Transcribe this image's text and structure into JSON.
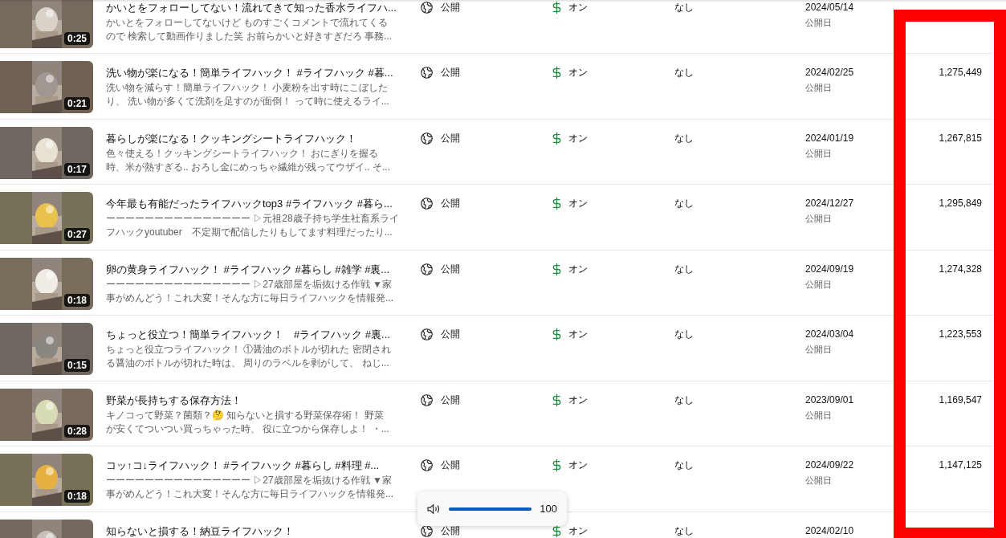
{
  "rows": [
    {
      "duration": "0:25",
      "title": "かいとをフォローしてない！流れてきて知った香水ライフハ...",
      "description_lines": [
        "かいとをフォローしてないけど ものすごくコメントで流れてくる",
        "ので 検索して動画作りました笑 お前らかいと好きすぎだろ 事務..."
      ],
      "visibility": "公開",
      "monetization": "オン",
      "restrictions": "なし",
      "date": "2024/05/14",
      "date_label": "公開日"
    },
    {
      "duration": "0:21",
      "title": "洗い物が楽になる！簡単ライフハック！ #ライフハック #暮...",
      "description_lines": [
        "洗い物を減らす！簡単ライフハック！ 小麦粉を出す時にこぼした",
        "り、 洗い物が多くて洗剤を足すのが面倒！ って時に使えるライ..."
      ],
      "visibility": "公開",
      "monetization": "オン",
      "restrictions": "なし",
      "date": "2024/02/25",
      "date_label": "公開日",
      "views": "1,275,449"
    },
    {
      "duration": "0:17",
      "title": "暮らしが楽になる！クッキングシートライフハック！",
      "description_lines": [
        "色々使える！クッキングシートライフハック！ おにぎりを握る",
        "時、米が熱すぎる.. おろし金にめっちゃ繊維が残ってウザイ.. そ..."
      ],
      "visibility": "公開",
      "monetization": "オン",
      "restrictions": "なし",
      "date": "2024/01/19",
      "date_label": "公開日",
      "views": "1,267,815"
    },
    {
      "duration": "0:27",
      "title": "今年最も有能だったライフハックtop3 #ライフハック #暮ら...",
      "description_lines": [
        "ーーーーーーーーーーーーーーー ▷元祖28歳子持ち学生社畜系ライ",
        "フハックyoutuber　不定期で配信したりもしてます料理だったり..."
      ],
      "visibility": "公開",
      "monetization": "オン",
      "restrictions": "なし",
      "date": "2024/12/27",
      "date_label": "公開日",
      "views": "1,295,849"
    },
    {
      "duration": "0:18",
      "title": "卵の黄身ライフハック！ #ライフハック #暮らし #雑学 #裏...",
      "description_lines": [
        "ーーーーーーーーーーーーーーー ▷27歳部屋を垢抜ける作戦 ▼家",
        "事がめんどう！これ大変！そんな方に毎日ライフハックを情報発..."
      ],
      "visibility": "公開",
      "monetization": "オン",
      "restrictions": "なし",
      "date": "2024/09/19",
      "date_label": "公開日",
      "views": "1,274,328"
    },
    {
      "duration": "0:15",
      "title": "ちょっと役立つ！簡単ライフハック！　#ライフハック #裏...",
      "description_lines": [
        "ちょっと役立つライフハック！ ①醤油のボトルが切れた 密閉され",
        "る醤油のボトルが切れた時は、 周りのラベルを剥がして、 ねじ..."
      ],
      "visibility": "公開",
      "monetization": "オン",
      "restrictions": "なし",
      "date": "2024/03/04",
      "date_label": "公開日",
      "views": "1,223,553"
    },
    {
      "duration": "0:28",
      "title": "野菜が長持ちする保存方法！",
      "description_lines": [
        "キノコって野菜？菌類？🤔 知らないと損する野菜保存術！ 野菜",
        "が安くてついつい買っちゃった時、 役に立つから保存しよ！ ・..."
      ],
      "visibility": "公開",
      "monetization": "オン",
      "restrictions": "なし",
      "date": "2023/09/01",
      "date_label": "公開日",
      "views": "1,169,547"
    },
    {
      "duration": "0:18",
      "title": "コッ↑コ↓ライフハック！ #ライフハック #暮らし #料理 #...",
      "description_lines": [
        "ーーーーーーーーーーーーーーー ▷27歳部屋を垢抜ける作戦 ▼家",
        "事がめんどう！これ大変！そんな方に毎日ライフハックを情報発..."
      ],
      "visibility": "公開",
      "monetization": "オン",
      "restrictions": "なし",
      "date": "2024/09/22",
      "date_label": "公開日",
      "views": "1,147,125"
    },
    {
      "title": "知らないと損する！納豆ライフハック！",
      "visibility": "公開",
      "monetization": "オン",
      "restrictions": "なし",
      "date": "2024/02/10"
    }
  ],
  "volume": {
    "level": 1,
    "reading": "100"
  }
}
